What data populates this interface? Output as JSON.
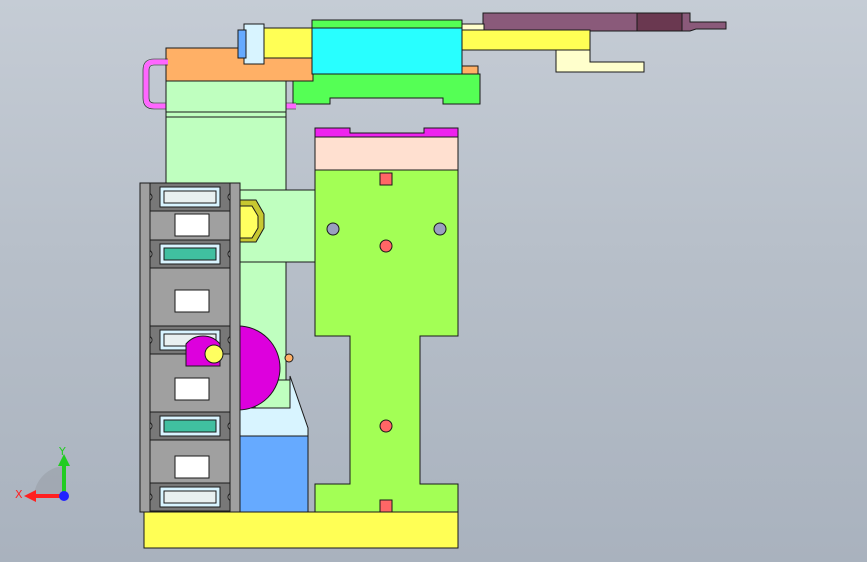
{
  "viewport": {
    "background_top": "#c5ccd5",
    "background_bottom": "#a9b2be"
  },
  "colors": {
    "outline": "#1a1a1a",
    "yellow": "#ffff55",
    "cyan": "#28ffff",
    "green": "#55ff55",
    "light_green": "#bfffbf",
    "lime": "#a3ff55",
    "orange": "#ffb066",
    "pink": "#ff66ff",
    "peach": "#ffe0d0",
    "magenta": "#dd00dd",
    "purple": "#8a5a7a",
    "dark_purple": "#6a3850",
    "cream": "#ffffcc",
    "blue": "#66aaff",
    "pale_blue": "#d8f4ff",
    "grey": "#a0a0a0",
    "dark_grey": "#787878",
    "teal": "#40c0a0",
    "red_dot": "#ff6666"
  },
  "triad": {
    "x_label": "X",
    "y_label": "Y",
    "x_color": "#ff2020",
    "y_color": "#22cc22",
    "z_color": "#2222ff"
  }
}
